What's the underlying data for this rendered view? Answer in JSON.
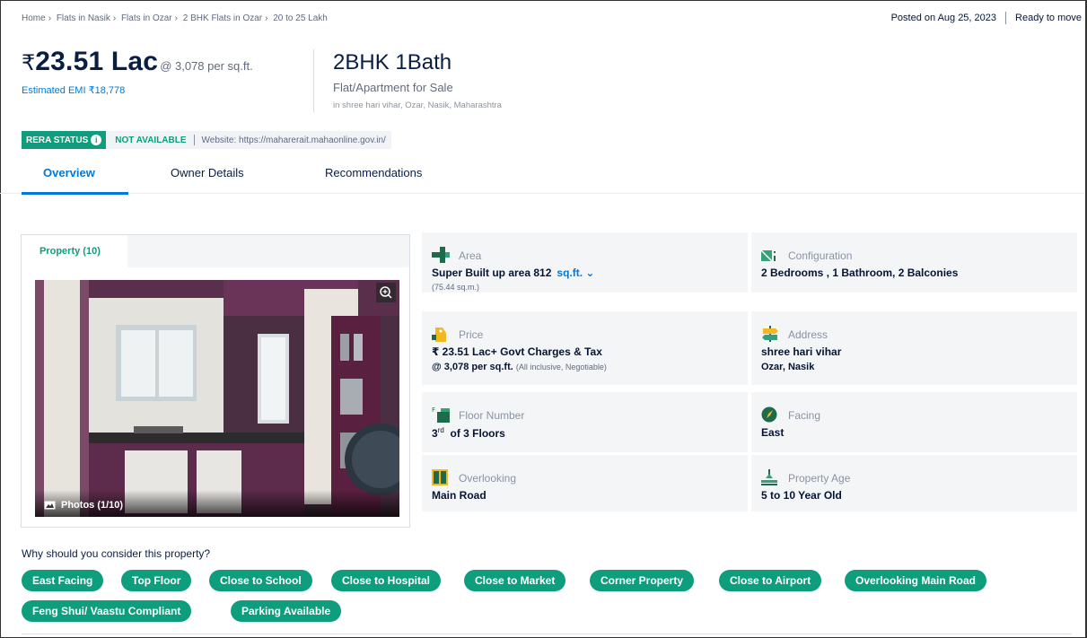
{
  "breadcrumb": [
    "Home",
    "Flats in Nasik",
    "Flats in Ozar",
    "2 BHK Flats in Ozar",
    "20 to 25 Lakh"
  ],
  "posted": {
    "date": "Posted on Aug 25, 2023",
    "status": "Ready to move"
  },
  "price": {
    "currency": "₹",
    "amount": "23.51 Lac",
    "per_sqft": "@ 3,078 per sq.ft.",
    "emi": "Estimated EMI ₹18,778"
  },
  "title": {
    "bhk": "2BHK 1Bath",
    "type": "Flat/Apartment for Sale",
    "locality": "in shree hari vihar, Ozar, Nasik, Maharashtra"
  },
  "rera": {
    "badge": "RERA STATUS",
    "status": "NOT AVAILABLE",
    "website": "Website: https://maharerait.mahaonline.gov.in/"
  },
  "tabs": [
    "Overview",
    "Owner Details",
    "Recommendations"
  ],
  "gallery": {
    "tab": "Property (10)",
    "photos_label": "Photos (1/10)"
  },
  "details": {
    "area": {
      "label": "Area",
      "value": "Super Built up area 812",
      "unit": "sq.ft.",
      "note": "(75.44 sq.m.)"
    },
    "configuration": {
      "label": "Configuration",
      "value": "2 Bedrooms , 1 Bathroom, 2 Balconies"
    },
    "price": {
      "label": "Price",
      "value": "₹ 23.51 Lac+ Govt Charges & Tax",
      "line2": "@ 3,078 per sq.ft.",
      "note": "(All inclusive, Negotiable)"
    },
    "address": {
      "label": "Address",
      "line1": "shree hari vihar",
      "line2": "Ozar, Nasik"
    },
    "floor": {
      "label": "Floor Number",
      "floor": "3",
      "suffix": "rd",
      "value": "of 3 Floors"
    },
    "facing": {
      "label": "Facing",
      "value": "East"
    },
    "overlooking": {
      "label": "Overlooking",
      "value": "Main Road"
    },
    "age": {
      "label": "Property Age",
      "value": "5 to 10 Year Old"
    }
  },
  "why": {
    "heading": "Why should you consider this property?",
    "chips": [
      "East Facing",
      "Top Floor",
      "Close to School",
      "Close to Hospital",
      "Close to Market",
      "Corner Property",
      "Close to Airport",
      "Overlooking Main Road",
      "Feng Shui/ Vaastu Compliant",
      "Parking Available"
    ]
  },
  "colors": {
    "accent": "#0078db",
    "green": "#0e9e7e",
    "text": "#091e42"
  }
}
